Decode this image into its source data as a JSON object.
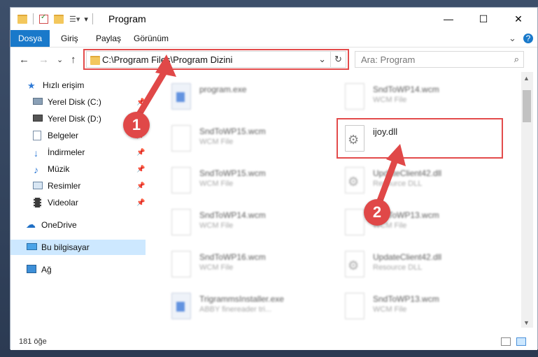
{
  "window": {
    "title": "Program"
  },
  "titlebar": {
    "minimize": "—",
    "maximize": "☐",
    "close": "✕"
  },
  "ribbon": {
    "tabs": [
      "Dosya",
      "Giriş",
      "Paylaş",
      "Görünüm"
    ],
    "expand": "⌄",
    "help": "?"
  },
  "nav_buttons": {
    "back": "←",
    "forward": "→",
    "recent": "⌄",
    "up": "↑"
  },
  "address": {
    "path": "C:\\Program Files\\Program Dizini",
    "dropdown": "⌄",
    "refresh": "↻"
  },
  "search": {
    "placeholder": "Ara: Program",
    "icon": "⌕"
  },
  "sidebar": {
    "items": [
      {
        "label": "Hızlı erişim",
        "icon": "star-icon"
      },
      {
        "label": "Yerel Disk (C:)",
        "icon": "drive-icon",
        "pinned": true
      },
      {
        "label": "Yerel Disk (D:)",
        "icon": "drive-icon",
        "pinned": true
      },
      {
        "label": "Belgeler",
        "icon": "documents-icon",
        "pinned": true
      },
      {
        "label": "İndirmeler",
        "icon": "download-icon",
        "pinned": true
      },
      {
        "label": "Müzik",
        "icon": "music-icon",
        "pinned": true
      },
      {
        "label": "Resimler",
        "icon": "pictures-icon",
        "pinned": true
      },
      {
        "label": "Videolar",
        "icon": "video-icon",
        "pinned": true
      },
      {
        "label": "OneDrive",
        "icon": "cloud-icon"
      },
      {
        "label": "Bu bilgisayar",
        "icon": "computer-icon"
      },
      {
        "label": "Ağ",
        "icon": "network-icon"
      }
    ],
    "pin_glyph": "📌"
  },
  "files": {
    "left": [
      {
        "name": "program.exe",
        "type": "",
        "icon": "app-icon"
      },
      {
        "name": "SndToWP15.wcm",
        "type": "WCM File",
        "icon": "file-icon"
      },
      {
        "name": "SndToWP15.wcm",
        "type": "WCM File",
        "icon": "file-icon"
      },
      {
        "name": "SndToWP14.wcm",
        "type": "WCM File",
        "icon": "file-icon"
      },
      {
        "name": "SndToWP16.wcm",
        "type": "WCM File",
        "icon": "file-icon"
      },
      {
        "name": "TrigrammsInstaller.exe",
        "type": "ABBY finereader tri...",
        "icon": "app-icon"
      }
    ],
    "right": [
      {
        "name": "SndToWP14.wcm",
        "type": "WCM File",
        "icon": "file-icon"
      },
      {
        "name": "ijoy.dll",
        "type": "",
        "icon": "dll-icon"
      },
      {
        "name": "UpdateClient42.dll",
        "type": "Resource DLL",
        "icon": "dll-icon"
      },
      {
        "name": "SndToWP13.wcm",
        "type": "WCM File",
        "icon": "file-icon"
      },
      {
        "name": "UpdateClient42.dll",
        "type": "Resource DLL",
        "icon": "dll-icon"
      },
      {
        "name": "SndToWP13.wcm",
        "type": "WCM File",
        "icon": "file-icon"
      }
    ]
  },
  "annotations": {
    "badge1": "1",
    "badge2": "2"
  },
  "status": {
    "count": "181 öğe"
  },
  "colors": {
    "accent": "#1979ca",
    "highlight": "#e34b4b",
    "selected": "#cde8ff"
  }
}
